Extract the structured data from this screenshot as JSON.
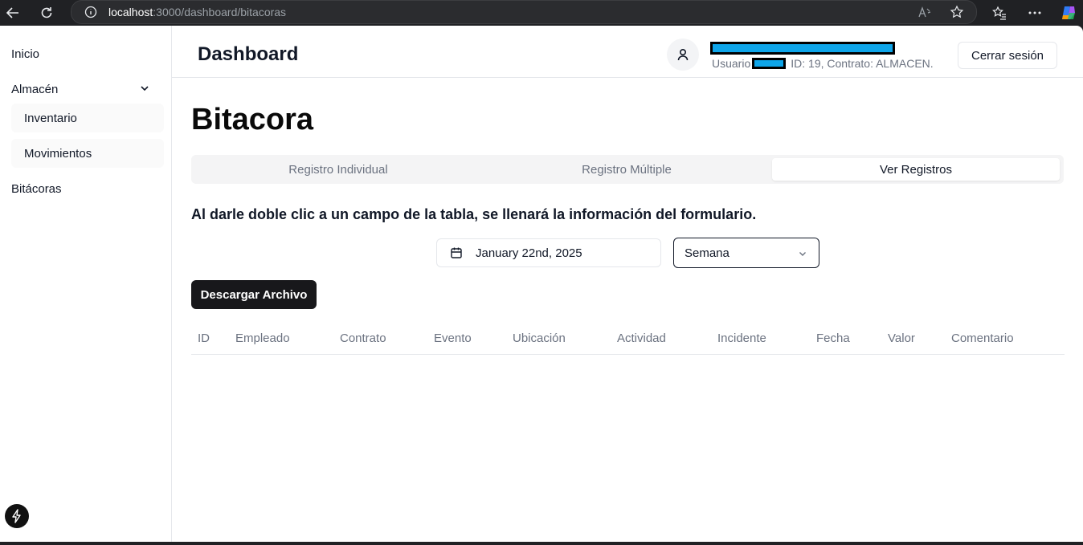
{
  "browser": {
    "url_host": "localhost",
    "url_path": ":3000/dashboard/bitacoras",
    "icons": [
      "back-icon",
      "reload-icon",
      "info-icon",
      "read-aloud-icon",
      "favorite-icon",
      "favorites-list-icon",
      "more-icon",
      "copilot-icon"
    ]
  },
  "sidebar": {
    "items": [
      {
        "label": "Inicio"
      },
      {
        "label": "Almacén",
        "expanded": true
      },
      {
        "label": "Inventario"
      },
      {
        "label": "Movimientos"
      },
      {
        "label": "Bitácoras"
      }
    ]
  },
  "header": {
    "title": "Dashboard",
    "user_label": "Usuario",
    "user_meta": "ID: 19,  Contrato: ALMACEN.",
    "logout_label": "Cerrar sesión"
  },
  "main": {
    "title": "Bitacora",
    "tabs": [
      {
        "label": "Registro Individual",
        "active": false
      },
      {
        "label": "Registro Múltiple",
        "active": false
      },
      {
        "label": "Ver Registros",
        "active": true
      }
    ],
    "hint": "Al darle doble clic a un campo de la tabla, se llenará la información del formulario.",
    "date_value": "January 22nd, 2025",
    "period_select": "Semana",
    "download_label": "Descargar Archivo",
    "table": {
      "columns": [
        "ID",
        "Empleado",
        "Contrato",
        "Evento",
        "Ubicación",
        "Actividad",
        "Incidente",
        "Fecha",
        "Valor",
        "Comentario"
      ],
      "rows": []
    }
  },
  "colors": {
    "primary_button": "#18181b",
    "redaction": "#0ea5e9"
  }
}
